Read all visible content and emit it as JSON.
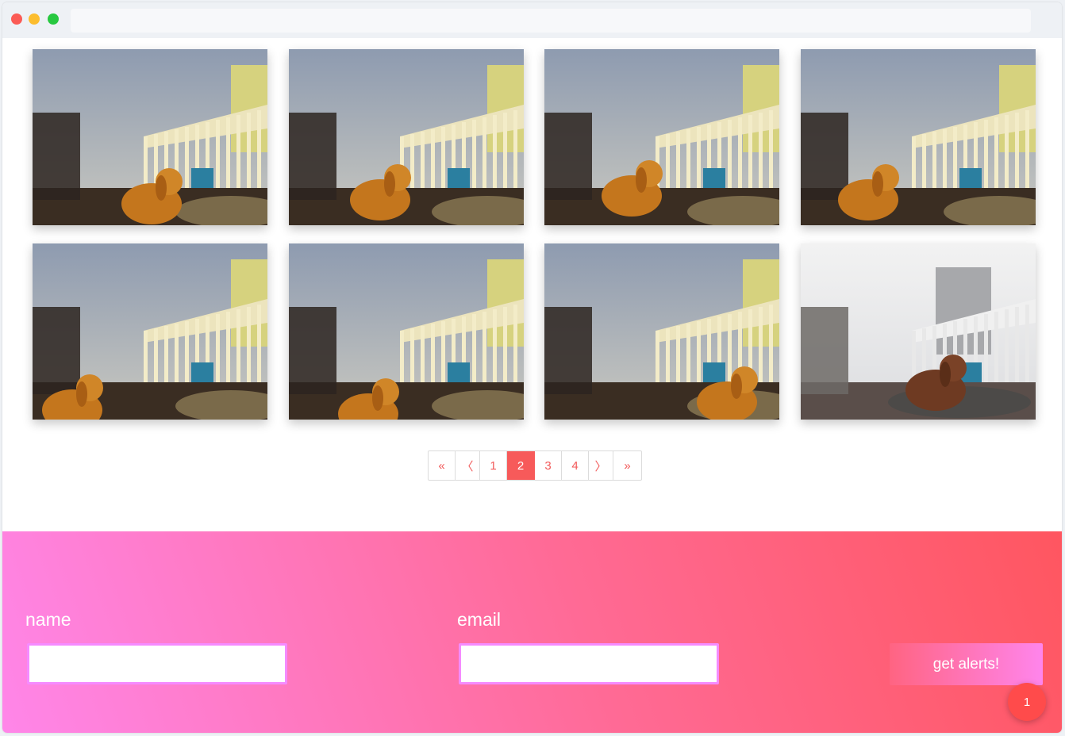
{
  "gallery": {
    "images": [
      {
        "alt": "dog on balcony 1"
      },
      {
        "alt": "dog on balcony 2"
      },
      {
        "alt": "dog on balcony 3"
      },
      {
        "alt": "dog on balcony 4"
      },
      {
        "alt": "dog on balcony 5"
      },
      {
        "alt": "dog on balcony 6"
      },
      {
        "alt": "dog on balcony 7"
      },
      {
        "alt": "dog on balcony 8"
      }
    ]
  },
  "pagination": {
    "first": "«",
    "prev": "〈",
    "pages": [
      "1",
      "2",
      "3",
      "4"
    ],
    "current": "2",
    "next": "〉",
    "last": "»"
  },
  "signup": {
    "name_label": "name",
    "email_label": "email",
    "name_value": "",
    "email_value": "",
    "submit_label": "get alerts!"
  },
  "notification": {
    "count": "1"
  },
  "colors": {
    "accent": "#f75a5a",
    "gradient_start": "#ff86e9",
    "gradient_end": "#ff5660"
  }
}
